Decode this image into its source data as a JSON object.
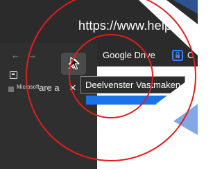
{
  "address_bar": {
    "url": "https://www.help."
  },
  "bookmarks": {
    "google_drive": "Google Drive",
    "next_initial": "C"
  },
  "tab": {
    "title": "Microsoft",
    "title_continued": "are a",
    "close": "×"
  },
  "nav": {
    "back": "←",
    "forward": "→"
  },
  "tooltip": {
    "text": "Deelvenster Vastmaken"
  },
  "icons": {
    "pin": "pin-icon",
    "cursor": "mouse-cursor-icon",
    "lock": "lock-icon",
    "sidebar": "sidebar-icon",
    "close": "close-icon"
  },
  "colors": {
    "highlight_circle": "#e01e1e",
    "accent_blue": "#1a73e8",
    "lock_blue": "#3b82f6"
  }
}
